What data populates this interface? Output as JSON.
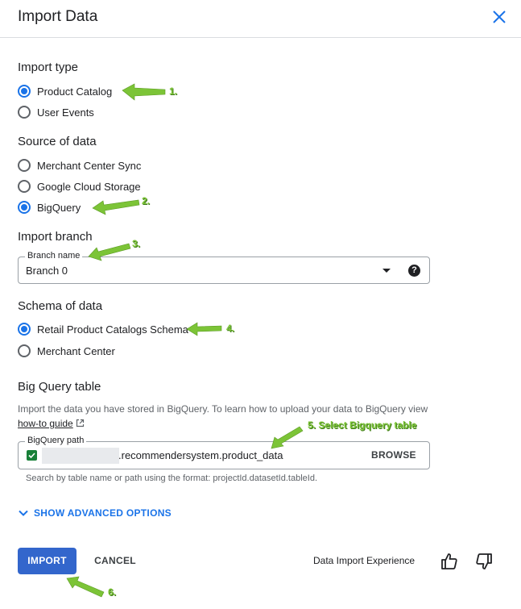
{
  "dialog": {
    "title": "Import Data"
  },
  "import_type": {
    "title": "Import type",
    "options": [
      {
        "label": "Product Catalog",
        "checked": true
      },
      {
        "label": "User Events",
        "checked": false
      }
    ]
  },
  "source": {
    "title": "Source of data",
    "options": [
      {
        "label": "Merchant Center Sync",
        "checked": false
      },
      {
        "label": "Google Cloud Storage",
        "checked": false
      },
      {
        "label": "BigQuery",
        "checked": true
      }
    ]
  },
  "branch": {
    "title": "Import branch",
    "field_label": "Branch name",
    "value": "Branch 0",
    "help": "?"
  },
  "schema": {
    "title": "Schema of data",
    "options": [
      {
        "label": "Retail Product Catalogs Schema",
        "checked": true
      },
      {
        "label": "Merchant Center",
        "checked": false
      }
    ]
  },
  "bq_table": {
    "title": "Big Query table",
    "description": "Import the data you have stored in BigQuery. To learn how to upload your data to BigQuery view",
    "link": "how-to guide",
    "field_label": "BigQuery path",
    "value": ".recommendersystem.product_data",
    "browse": "BROWSE",
    "hint": "Search by table name or path using the format: projectId.datasetId.tableId."
  },
  "advanced": {
    "label": "SHOW ADVANCED OPTIONS"
  },
  "footer": {
    "import": "IMPORT",
    "cancel": "CANCEL",
    "feedback": "Data Import Experience"
  },
  "annotations": {
    "color": "#7cc437",
    "labels": [
      "1.",
      "2.",
      "3.",
      "4.",
      "5. Select Bigquery table",
      "6."
    ]
  },
  "icons": {
    "close": "close-icon",
    "dropdown": "dropdown-arrow-icon",
    "help": "help-icon",
    "external": "external-link-icon",
    "check": "check-icon",
    "chevron": "chevron-down-icon",
    "thumbs_up": "thumbs-up-icon",
    "thumbs_down": "thumbs-down-icon"
  },
  "colors": {
    "accent": "#1a73e8",
    "primary_button": "#3366cc",
    "check": "#188038"
  }
}
